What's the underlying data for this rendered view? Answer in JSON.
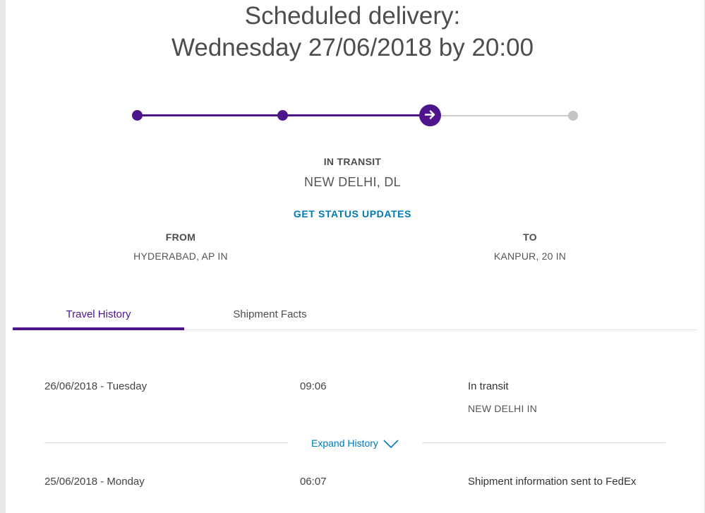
{
  "header": {
    "line1": "Scheduled delivery:",
    "line2": "Wednesday 27/06/2018 by 20:00"
  },
  "progress": {
    "steps_total": 4,
    "current_step": 3,
    "icon": "arrow-right-icon",
    "colors": {
      "complete": "#4d148c",
      "pending": "#c4c4c4"
    }
  },
  "status": {
    "label": "IN TRANSIT",
    "location": "NEW DELHI, DL",
    "updates_link": "GET STATUS UPDATES"
  },
  "route": {
    "from_label": "FROM",
    "from_value": "HYDERABAD, AP IN",
    "to_label": "TO",
    "to_value": "KANPUR, 20 IN"
  },
  "tabs": [
    {
      "label": "Travel History",
      "active": true
    },
    {
      "label": "Shipment Facts",
      "active": false
    }
  ],
  "history": [
    {
      "date": "26/06/2018 - Tuesday",
      "time": "09:06",
      "event": "In transit",
      "location": "NEW DELHI IN"
    },
    {
      "date": "25/06/2018 - Monday",
      "time": "06:07",
      "event": "Shipment information sent to FedEx",
      "location": ""
    }
  ],
  "expand": {
    "label": "Expand History",
    "icon": "chevron-down-icon"
  },
  "colors": {
    "brand_purple": "#4d148c",
    "link_blue": "#007ab7"
  }
}
